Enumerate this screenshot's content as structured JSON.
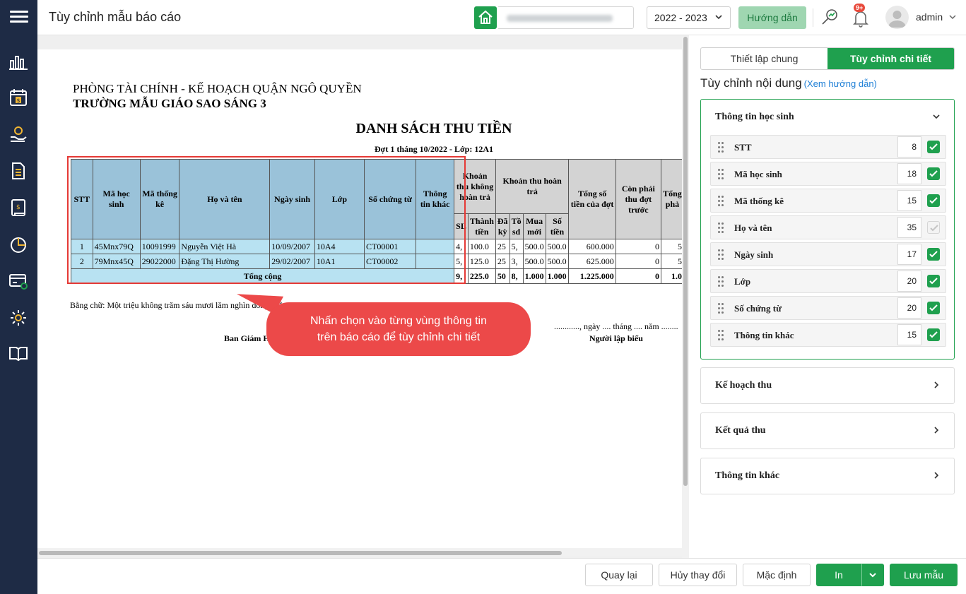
{
  "header": {
    "title": "Tùy chỉnh mẫu báo cáo",
    "year": "2022 - 2023",
    "guide_label": "Hướng dẫn",
    "notif_count": "9+",
    "user": "admin"
  },
  "sidebar": {
    "icons": [
      "reports-chart-icon",
      "calendar-fee-icon",
      "money-hand-icon",
      "document-icon",
      "ledger-icon",
      "pie-chart-icon",
      "payment-card-icon",
      "settings-gear-icon",
      "book-open-icon"
    ]
  },
  "report": {
    "org_line1": "PHÒNG TÀI CHÍNH - KẾ HOẠCH QUẬN NGÔ QUYỀN",
    "org_line2": "TRƯỜNG MẪU GIÁO SAO SÁNG 3",
    "title": "DANH SÁCH THU TIỀN",
    "subtitle": "Đợt 1 tháng 10/2022 - Lớp: 12A1",
    "headers": {
      "stt": "STT",
      "ma_hs": "Mã học sinh",
      "ma_tk": "Mã thống kê",
      "ho_ten": "Họ và tên",
      "ngay_sinh": "Ngày sinh",
      "lop": "Lớp",
      "so_ct": "Số chứng từ",
      "ttk": "Thông tin khác",
      "khoan_thu": "Khoản thu không hoàn trả",
      "khoan_hoan": "Khoản thu hoàn trả",
      "tong_dot": "Tổng số tiền của đợt",
      "con_phai": "Còn phải thu đợt trước",
      "tong_phai": "Tổng phả",
      "sl": "SL",
      "thanh_tien": "Thành tiền",
      "da_ky": "Đã kỳ",
      "to_sd": "Tồ sd",
      "mua_moi": "Mua mới",
      "so_tien": "Số tiền"
    },
    "rows": [
      [
        "1",
        "45Mnx79Q",
        "10091999",
        "Nguyễn Việt Hà",
        "10/09/2007",
        "10A4",
        "CT00001",
        "",
        "4,",
        "100.0",
        "25",
        "5,",
        "500.0",
        "500.0",
        "600.000",
        "0",
        "5"
      ],
      [
        "2",
        "79Mnx45Q",
        "29022000",
        "Đặng Thị Hường",
        "29/02/2007",
        "10A1",
        "CT00002",
        "",
        "5,",
        "125.0",
        "25",
        "3,",
        "500.0",
        "500.0",
        "625.000",
        "0",
        "5"
      ]
    ],
    "total": {
      "label": "Tổng cộng",
      "values": [
        "9,",
        "225.0",
        "50",
        "8,",
        "1.000",
        "1.000",
        "1.225.000",
        "0",
        "1.0"
      ]
    },
    "in_words": "Bằng chữ: Một triệu không trăm sáu mươi lăm nghìn đồng chẵn",
    "sign_left": "Ban Giám Hiệu",
    "sign_date": "............, ngày .... tháng .... năm ........",
    "sign_right": "Người lập biểu",
    "tooltip_line1": "Nhấn chọn vào từng vùng thông tin",
    "tooltip_line2": "trên báo cáo để tùy chỉnh chi tiết"
  },
  "panel": {
    "tabs": [
      "Thiết lập chung",
      "Tùy chỉnh chi tiết"
    ],
    "section_title": "Tùy chỉnh nội dung",
    "section_link": "(Xem hướng dẫn)",
    "group_open": "Thông tin học sinh",
    "fields": [
      {
        "label": "STT",
        "width": "8",
        "checked": true
      },
      {
        "label": "Mã học sinh",
        "width": "18",
        "checked": true
      },
      {
        "label": "Mã thống kê",
        "width": "15",
        "checked": true
      },
      {
        "label": "Họ và tên",
        "width": "35",
        "checked": false
      },
      {
        "label": "Ngày sinh",
        "width": "17",
        "checked": true
      },
      {
        "label": "Lớp",
        "width": "20",
        "checked": true
      },
      {
        "label": "Số chứng từ",
        "width": "20",
        "checked": true
      },
      {
        "label": "Thông tin khác",
        "width": "15",
        "checked": true
      }
    ],
    "groups_closed": [
      "Kế hoạch thu",
      "Kết quả thu",
      "Thông tin khác"
    ]
  },
  "footer": {
    "back": "Quay lại",
    "cancel": "Hủy thay đổi",
    "default": "Mặc định",
    "print": "In",
    "save": "Lưu mẫu"
  },
  "colors": {
    "primary": "#1fa04e",
    "sidebar": "#1e2b45",
    "highlight_header": "#9ac2d9",
    "highlight_cell": "#b8e2f2",
    "callout": "#ec4949"
  }
}
